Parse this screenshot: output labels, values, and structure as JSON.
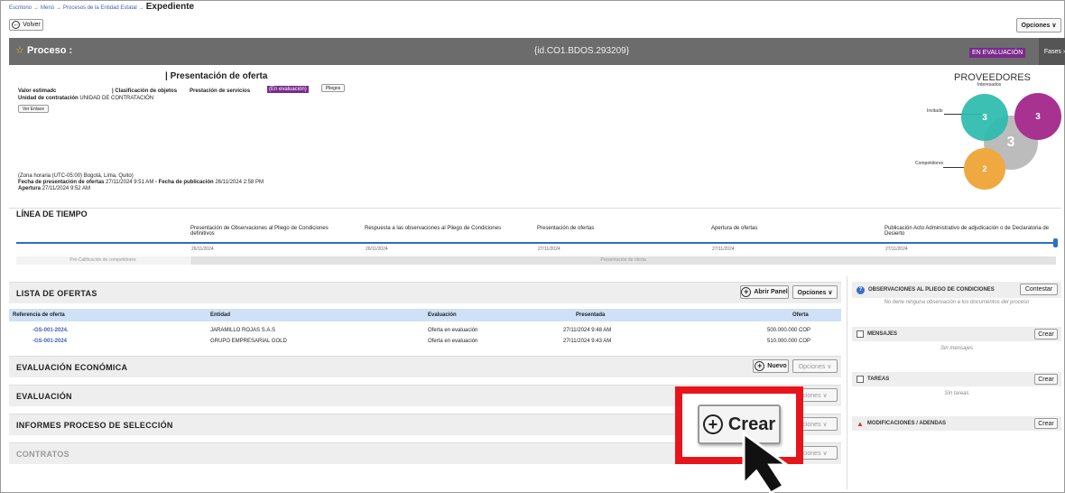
{
  "breadcrumb": {
    "items": [
      "Escritorio",
      "Menú",
      "Procesos de la Entidad Estatal"
    ],
    "current": "Expediente",
    "sep": "→"
  },
  "toolbar": {
    "back": "Volver",
    "options": "Opciones ∨"
  },
  "process": {
    "label": "Proceso :",
    "id": "{id.CO1.BDOS.293209}",
    "status": "EN EVALUACIÓN",
    "phases": "Fases ›"
  },
  "details": {
    "title": "| Presentación de oferta",
    "value_label": "Valor estimadc",
    "class_label": "| Clasificación de objetos",
    "class_value": "Prestación de servicios",
    "eval_tag": "(En evaluación)",
    "pliegos": "Pliegos",
    "unit_label": "Unidad de contratación",
    "unit_value": "UNIDAD DE CONTRATACIÓN",
    "link_btn": "Ver Enlace",
    "tz": "(Zona horaria (UTC-05:00) Bogotá, Lima, Quito)",
    "pres_label": "Fecha de presentación de ofertas",
    "pres_value": "27/11/2024 9:51 AM",
    "pub_label": "- Fecha de publicación",
    "pub_value": "26/11/2024 2:58 PM",
    "open_label": "Apertura",
    "open_value": "27/11/2024 9:52 AM"
  },
  "providers": {
    "title": "PROVEEDORES",
    "interested": "Interesados",
    "invited": "Invitado",
    "competitors": "Competidores",
    "n_interested": "3",
    "n_invited": "3",
    "n_total": "3",
    "n_competitors": "2",
    "colors": {
      "invited": "#2bbbad",
      "interested": "#a83290",
      "total": "#b5b5b5",
      "competitors": "#f0a840"
    }
  },
  "timeline": {
    "title": "LÍNEA DE TIEMPO",
    "steps": [
      {
        "label": "Presentación de Observaciones al Pliego de Condiciones definitivos",
        "date": "26/11/2024"
      },
      {
        "label": "Respuesta a las observaciones al Pliego de Condiciones",
        "date": "26/11/2024"
      },
      {
        "label": "Presentación de ofertas",
        "date": "27/11/2024"
      },
      {
        "label": "Apertura de ofertas",
        "date": "27/11/2024"
      },
      {
        "label": "Publicación Acto Administrativo de adjudicación o de Declaratoria de Desierto",
        "date": "27/11/2024"
      }
    ],
    "phase_left": "Pré-Calificación de competidores",
    "phase_mid": "Presentación de oferta"
  },
  "offers": {
    "title": "LISTA DE OFERTAS",
    "open_panel": "Abrir Panel",
    "options": "Opciones ∨",
    "headers": [
      "Referencia de oferta",
      "Entidad",
      "Evaluación",
      "Presentada",
      "Oferta"
    ],
    "rows": [
      {
        "ref": "-GS-001-2024.",
        "entity": "JARAMILLO ROJAS S.A.S",
        "eval": "Oferta en evaluación",
        "date": "27/11/2024 9:48 AM",
        "amount": "500.000.000 COP"
      },
      {
        "ref": "-GS-001-2024",
        "entity": "GRUPO EMPRESARIAL GOLD",
        "eval": "Oferta en evaluación",
        "date": "27/11/2024 9:43 AM",
        "amount": "510.000.000 COP"
      }
    ]
  },
  "sections": {
    "econ": "EVALUACIÓN ECONÓMICA",
    "econ_new": "Nuevo",
    "econ_opts": "Opciones ∨",
    "eval": "EVALUACIÓN",
    "eval_opts": "ciones ∨",
    "reports": "INFORMES PROCESO DE SELECCIÓN",
    "reports_opts": "ciones ∨",
    "contracts": "CONTRATOS",
    "contracts_opts": "ciones ∨"
  },
  "right": {
    "obs_title": "OBSERVACIONES AL PLIEGO DE CONDICIONES",
    "obs_btn": "Contestar",
    "obs_note": "No tiene ninguna observación a los documentos del proceso",
    "msg_title": "MENSAJES",
    "msg_btn": "Crear",
    "msg_note": "Sin mensajes",
    "tasks_title": "TAREAS",
    "tasks_btn": "Crear",
    "tasks_note": "Sin tareas",
    "mods_title": "MODIFICACIONES / ADENDAS",
    "mods_btn": "Crear"
  },
  "callout": {
    "label": "Crear",
    "border": "#e8141b"
  }
}
